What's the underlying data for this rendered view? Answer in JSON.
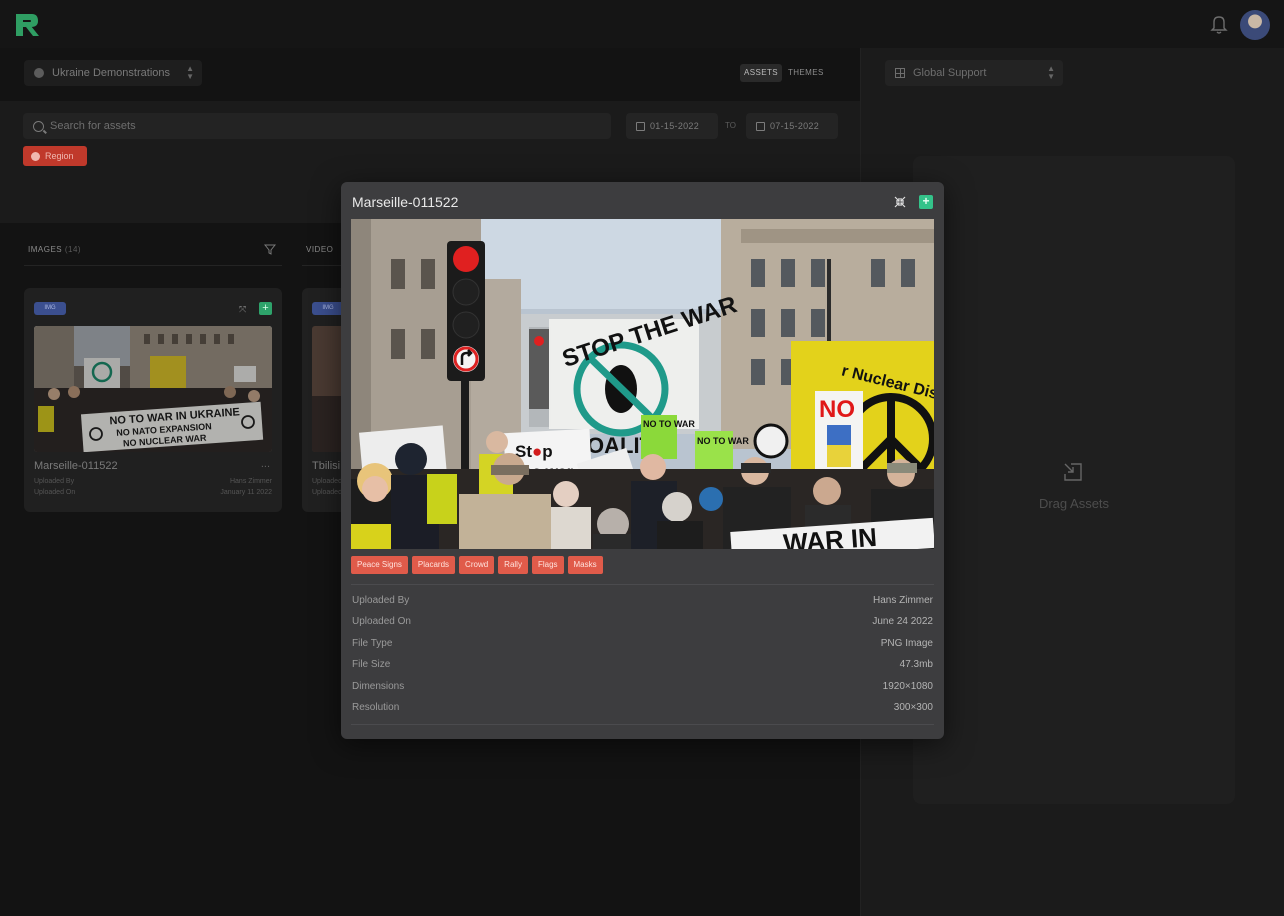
{
  "header": {
    "logo_icon": "r-logo-icon",
    "bell_icon": "bell-icon",
    "avatar_icon": "user-avatar"
  },
  "toolbar": {
    "project": "Ukraine Demonstrations",
    "view_tabs": [
      "ASSETS",
      "THEMES"
    ],
    "active_tab": "ASSETS",
    "theme_select": "Global Support"
  },
  "filters": {
    "search_placeholder": "Search for assets",
    "date_from": "01-15-2022",
    "date_to_label": "TO",
    "date_to": "07-15-2022",
    "active_filter": "Region"
  },
  "columns": {
    "images_label": "IMAGES",
    "images_count": "(14)",
    "video_label": "VIDEO"
  },
  "cards": [
    {
      "badge": "IMG",
      "title": "Marseille-011522",
      "uploaded_by_label": "Uploaded By",
      "uploaded_by": "Hans Zimmer",
      "uploaded_on_label": "Uploaded On",
      "uploaded_on": "January 11 2022",
      "menu": "..."
    },
    {
      "badge": "IMG",
      "title": "Tbilisi",
      "uploaded_by_label": "Uploaded By",
      "uploaded_on_label": "Uploaded On"
    }
  ],
  "right_panel": {
    "drop_text": "Drag Assets",
    "drop_icon": "drag-in-icon"
  },
  "modal": {
    "title": "Marseille-011522",
    "tags": [
      "Peace Signs",
      "Placards",
      "Crowd",
      "Rally",
      "Flags",
      "Masks"
    ],
    "details": [
      {
        "k": "Uploaded By",
        "v": "Hans Zimmer"
      },
      {
        "k": "Uploaded On",
        "v": "June 24 2022"
      },
      {
        "k": "File Type",
        "v": "PNG Image"
      },
      {
        "k": "File Size",
        "v": "47.3mb"
      },
      {
        "k": "Dimensions",
        "v": "1920×1080"
      },
      {
        "k": "Resolution",
        "v": "300×300"
      }
    ],
    "photo_signs": {
      "stop_war": "STOP THE WAR",
      "coalition": "OALIT",
      "stop_the_war_sign": "the war",
      "no_to_war": "NO TO WAR",
      "no": "NO",
      "nuclear": "r Nuclear Dis",
      "banner": "WAR IN"
    },
    "thumb_banner": [
      "NO TO WAR IN UKRAINE",
      "NO NATO EXPANSION",
      "NO NUCLEAR WAR"
    ]
  },
  "colors": {
    "accent_green": "#34c38a",
    "tag_red": "#e05b4a",
    "badge_blue": "#3b4f8f",
    "bg": "#1a1a1a"
  }
}
